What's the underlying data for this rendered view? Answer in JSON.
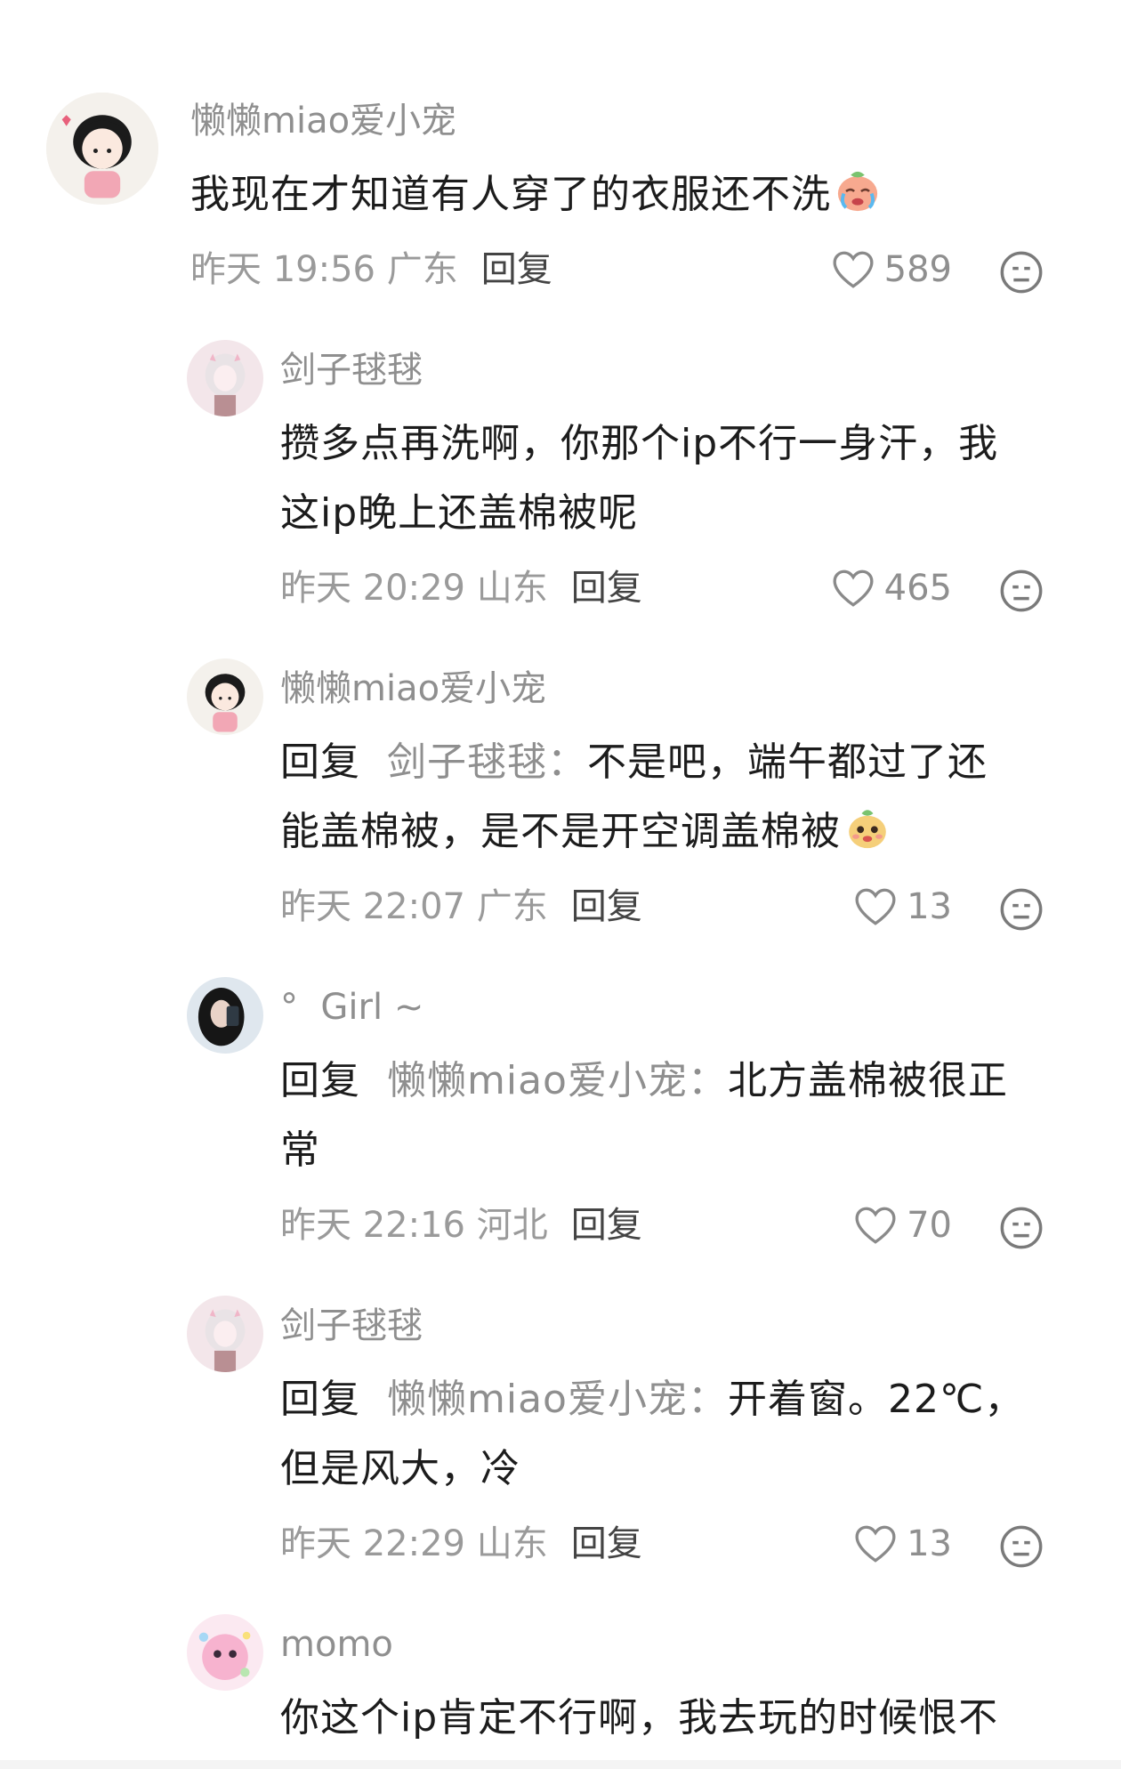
{
  "comments": [
    {
      "username": "懒懒miao爱小宠",
      "lines": [
        "我现在才知道有人穿了的衣服还不洗"
      ],
      "emoji": "crying-emoji",
      "time": "昨天 19:56 广东",
      "reply_label": "回复",
      "likes": "589"
    },
    {
      "username": "剑子毬毬",
      "lines": [
        "攒多点再洗啊，你那个ip不行一身汗，我",
        "这ip晚上还盖棉被呢"
      ],
      "time": "昨天 20:29 山东",
      "reply_label": "回复",
      "likes": "465"
    },
    {
      "username": "懒懒miao爱小宠",
      "reply_prefix": "回复",
      "reply_target": "剑子毬毬：",
      "lines": [
        "不是吧，端午都过了还",
        "能盖棉被，是不是开空调盖棉被"
      ],
      "emoji": "smiling-emoji",
      "time": "昨天 22:07 广东",
      "reply_label": "回复",
      "likes": "13"
    },
    {
      "username": "°  Girl ~",
      "reply_prefix": "回复",
      "reply_target": "懒懒miao爱小宠：",
      "lines": [
        "北方盖棉被很正",
        "常"
      ],
      "time": "昨天 22:16 河北",
      "reply_label": "回复",
      "likes": "70"
    },
    {
      "username": "剑子毬毬",
      "reply_prefix": "回复",
      "reply_target": "懒懒miao爱小宠：",
      "lines": [
        "开着窗。22℃，",
        "但是风大，冷"
      ],
      "time": "昨天 22:29 山东",
      "reply_label": "回复",
      "likes": "13"
    },
    {
      "username": "momo",
      "lines": [
        "你这个ip肯定不行啊，我去玩的时候恨不"
      ]
    }
  ],
  "colors": {
    "username": "#8f8f8f",
    "text": "#1c1c1c",
    "meta": "#9a9a9a",
    "reply_button": "#444444"
  }
}
